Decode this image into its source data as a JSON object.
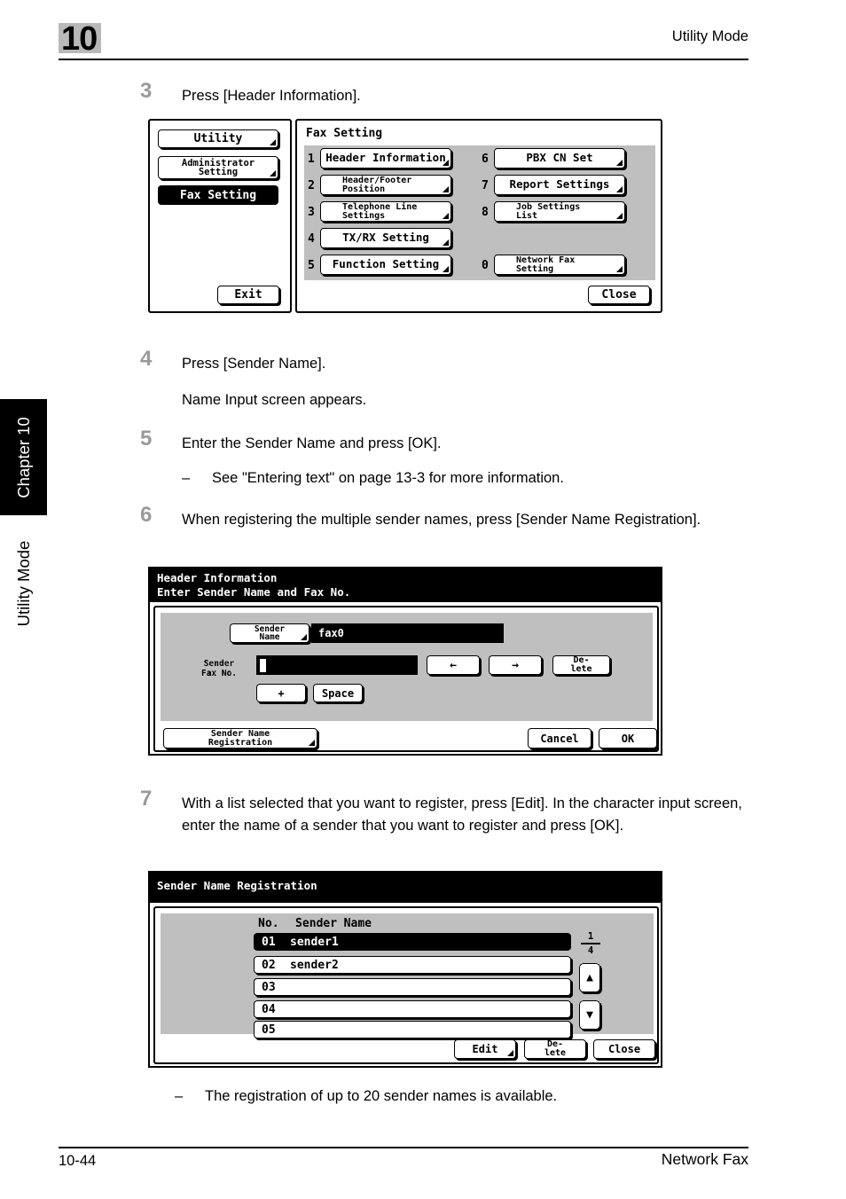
{
  "header": {
    "chapter_number": "10",
    "running_head": "Utility Mode"
  },
  "side_tab": {
    "chapter_label": "Chapter 10",
    "section_label": "Utility Mode"
  },
  "footer": {
    "page_number": "10-44",
    "document_title": "Network Fax"
  },
  "steps": [
    {
      "number": "3",
      "text": "Press [Header Information]."
    },
    {
      "number": "4",
      "text": "Press [Sender Name].",
      "sub_text": "Name Input screen appears."
    },
    {
      "number": "5",
      "text": "Enter the Sender Name and press [OK].",
      "bullet": "See \"Entering text\" on page 13-3 for more information."
    },
    {
      "number": "6",
      "text": "When registering the multiple sender names, press [Sender Name Registration]."
    },
    {
      "number": "7",
      "text": "With a list selected that you want to register, press [Edit]. In the character input screen, enter the name of a sender that you want to register and press [OK]."
    }
  ],
  "dash": "–",
  "note_after_step7": "The registration of up to 20 sender names is available.",
  "panel_fax_setting": {
    "title": "Fax Setting",
    "menu_items": [
      {
        "label": "Utility",
        "selected": false
      },
      {
        "label": "Administrator\nSetting",
        "selected": false
      },
      {
        "label": "Fax Setting",
        "selected": true
      }
    ],
    "exit_label": "Exit",
    "close_label": "Close",
    "left_column": [
      {
        "key": "1",
        "label": "Header Information"
      },
      {
        "key": "2",
        "label": "Header/Footer\nPosition"
      },
      {
        "key": "3",
        "label": "Telephone Line\nSettings"
      },
      {
        "key": "4",
        "label": "TX/RX Setting"
      },
      {
        "key": "5",
        "label": "Function Setting"
      }
    ],
    "right_column": [
      {
        "key": "6",
        "label": "PBX CN Set"
      },
      {
        "key": "7",
        "label": "Report Settings"
      },
      {
        "key": "8",
        "label": "Job Settings\nList"
      },
      {
        "key": "0",
        "label": "Network Fax\nSetting"
      }
    ]
  },
  "panel_header_info": {
    "title": "Header Information",
    "subtitle": "Enter Sender Name and Fax No.",
    "sender_name_button": "Sender\nName",
    "sender_name_value": "fax0",
    "sender_fax_label": "Sender\nFax No.",
    "sender_fax_value": "",
    "left_arrow": "←",
    "right_arrow": "→",
    "delete_label": "De-\nlete",
    "plus_label": "+",
    "space_label": "Space",
    "sender_name_registration_label": "Sender Name\nRegistration",
    "cancel_label": "Cancel",
    "ok_label": "OK"
  },
  "panel_sender_reg": {
    "title": "Sender Name Registration",
    "column_no": "No.",
    "column_name": "Sender Name",
    "page_current": "1",
    "page_total": "4",
    "rows": [
      {
        "no": "01",
        "name": "sender1",
        "selected": true
      },
      {
        "no": "02",
        "name": "sender2",
        "selected": false
      },
      {
        "no": "03",
        "name": "",
        "selected": false
      },
      {
        "no": "04",
        "name": "",
        "selected": false
      },
      {
        "no": "05",
        "name": "",
        "selected": false
      }
    ],
    "scroll_up_icon": "▲",
    "scroll_down_icon": "▼",
    "edit_label": "Edit",
    "delete_label": "De-\nlete",
    "close_label": "Close"
  }
}
